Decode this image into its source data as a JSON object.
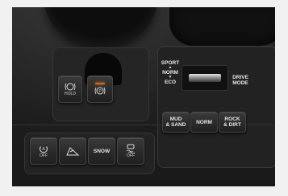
{
  "photo": {
    "subject": "Vehicle center console with parking brake, drive mode and terrain buttons"
  },
  "left_cluster": {
    "hold_label": "HOLD",
    "parking_brake_symbol": "P"
  },
  "drive_mode": {
    "sport": "SPORT",
    "norm": "NORM",
    "eco": "ECO",
    "title_line1": "DRIVE",
    "title_line2": "MODE"
  },
  "terrain": {
    "mud_sand_line1": "MUD",
    "mud_sand_line2": "& SAND",
    "norm": "NORM",
    "rock_dirt_line1": "ROCK",
    "rock_dirt_line2": "& DIRT"
  },
  "bottom_row": {
    "auto_stop_off": "OFF",
    "snow": "SNOW",
    "vsc_off": "OFF"
  },
  "colors": {
    "indicator": "#c96a1e"
  }
}
